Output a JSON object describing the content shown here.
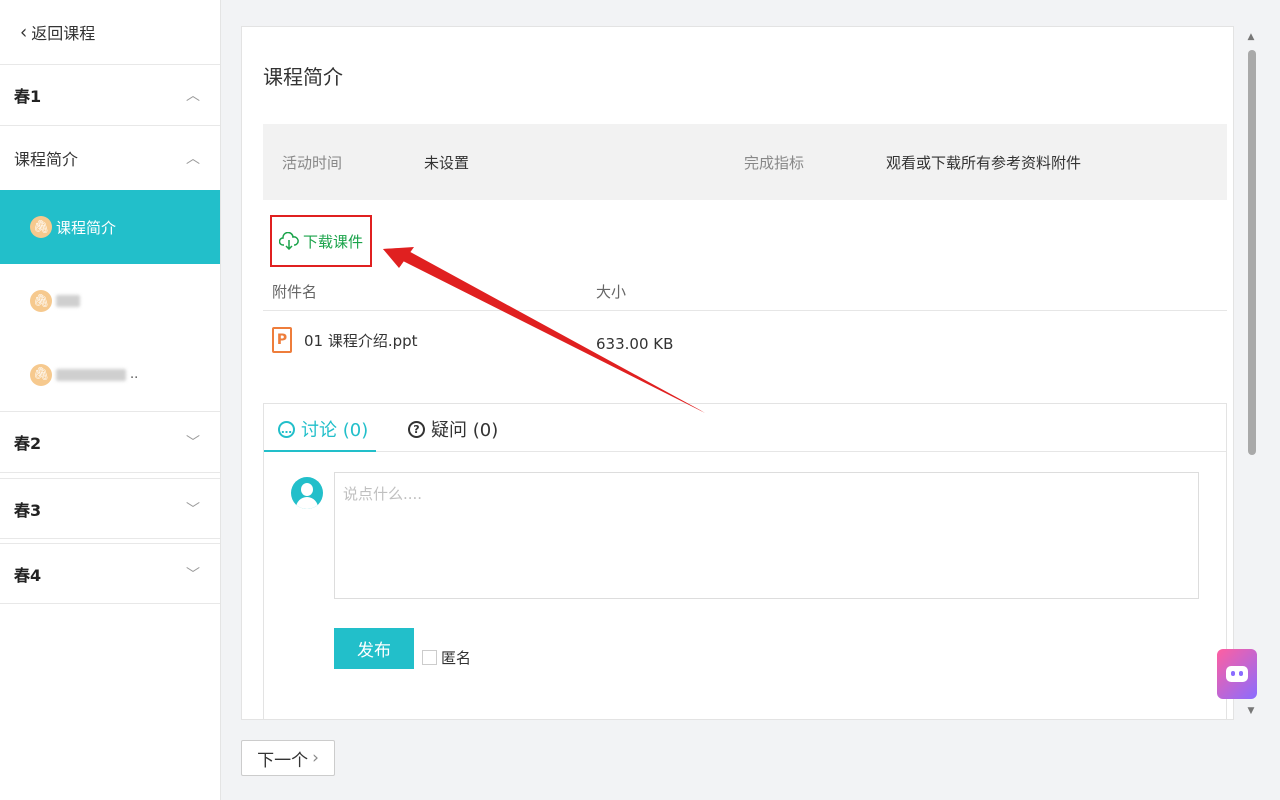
{
  "sidebar": {
    "back_label": "返回课程",
    "sections": [
      {
        "label": "春1",
        "expanded": true
      },
      {
        "label": "春2",
        "expanded": false
      },
      {
        "label": "春3",
        "expanded": false
      },
      {
        "label": "春4",
        "expanded": false
      }
    ],
    "subsection": {
      "label": "课程简介",
      "expanded": true
    },
    "items": [
      {
        "label": "课程简介",
        "active": true
      }
    ]
  },
  "main": {
    "title": "课程简介",
    "info": {
      "activity_time_label": "活动时间",
      "activity_time_value": "未设置",
      "completion_label": "完成指标",
      "completion_value": "观看或下载所有参考资料附件"
    },
    "download_label": "下载课件",
    "table": {
      "headers": [
        "附件名",
        "大小"
      ],
      "rows": [
        {
          "name": "01 课程介绍.ppt",
          "size": "633.00 KB",
          "icon": "P"
        }
      ]
    },
    "discussion": {
      "tabs": [
        {
          "label": "讨论 (0)",
          "icon": "chat-icon",
          "active": true
        },
        {
          "label": "疑问 (0)",
          "icon": "question-icon",
          "active": false
        }
      ],
      "placeholder": "说点什么....",
      "publish_label": "发布",
      "anonymous_label": "匿名"
    }
  },
  "next_label": "下一个",
  "colors": {
    "accent": "#22bfca",
    "download_green": "#1aa34a",
    "highlight_red": "#e02020",
    "ppt_orange": "#ee7d3b"
  }
}
